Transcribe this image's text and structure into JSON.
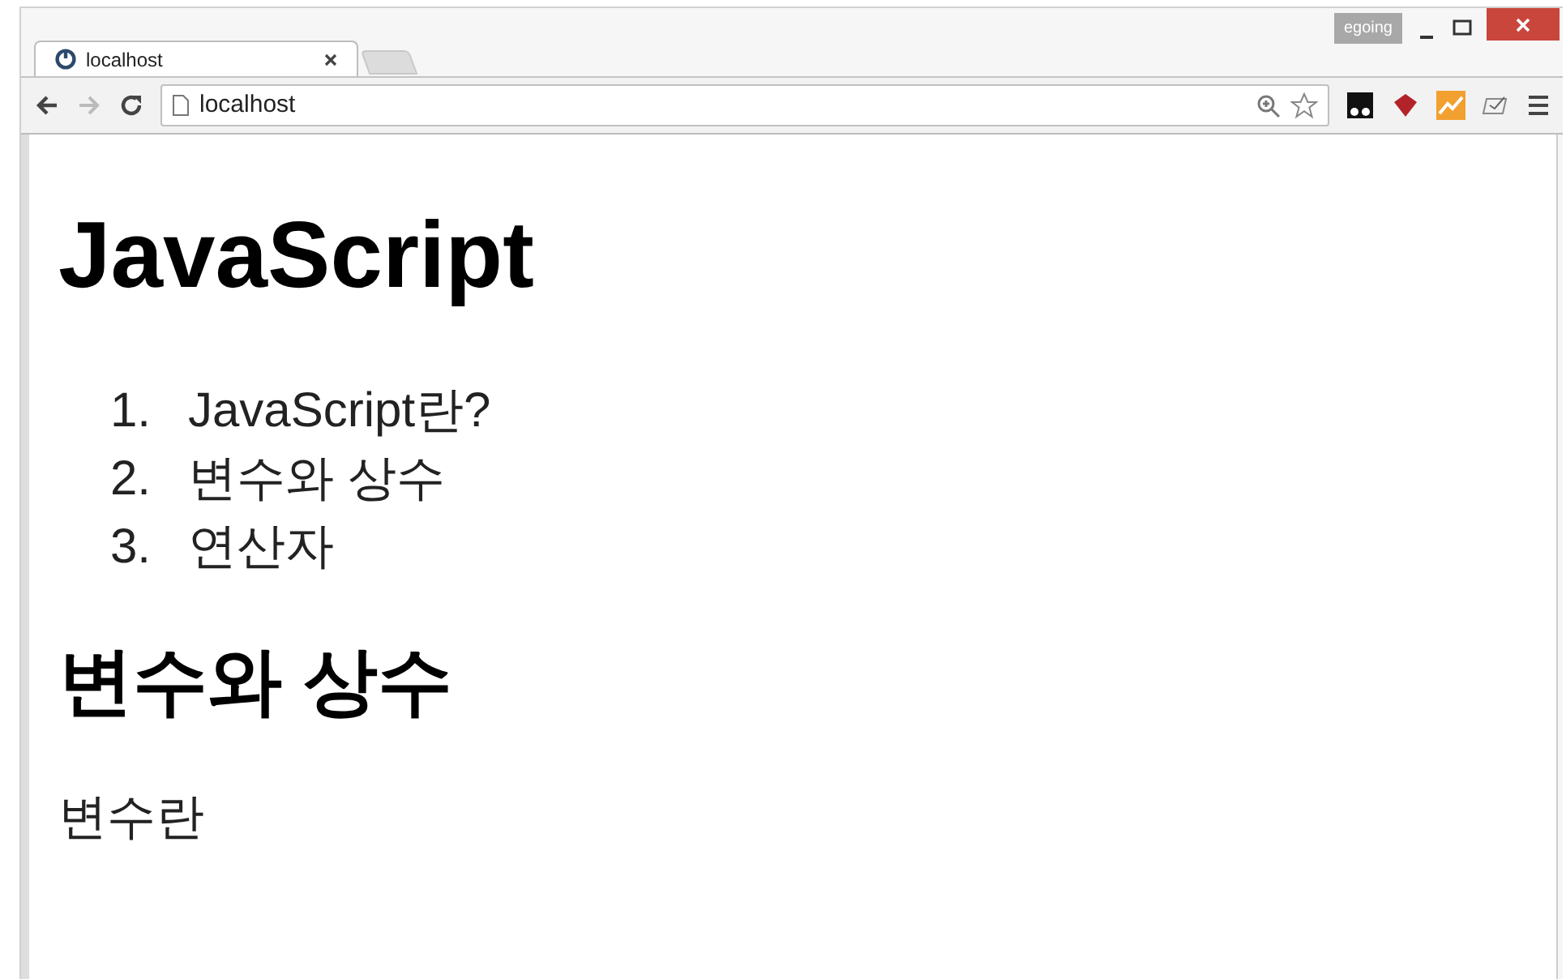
{
  "window": {
    "profile": "egoing"
  },
  "tab": {
    "title": "localhost"
  },
  "address_bar": {
    "url": "localhost"
  },
  "page": {
    "heading": "JavaScript",
    "contents": [
      {
        "number": "1.",
        "title": "JavaScript란?"
      },
      {
        "number": "2.",
        "title": "변수와 상수"
      },
      {
        "number": "3.",
        "title": "연산자"
      }
    ],
    "section_heading": "변수와 상수",
    "paragraph": "변수란"
  }
}
